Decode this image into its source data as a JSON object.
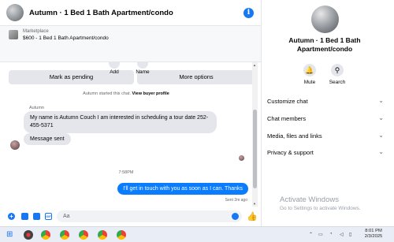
{
  "chat": {
    "header_title": "Autumn · 1 Bed 1 Bath Apartment/condo",
    "marketplace_label": "Marketplace",
    "listing": "$600 - 1 Bed 1 Bath Apartment/condo",
    "mark_pending_label": "Mark as pending",
    "more_options_label": "More options",
    "actions": {
      "add_label": "Add",
      "name_label": "Name"
    },
    "system_prefix": "Autumn started this chat.",
    "system_link": "View buyer profile",
    "sender_name": "Autumn",
    "incoming_message": "My name is Autumn Couch I am interested in scheduling a tour date 252-455-5371",
    "message_sent_label": "Message sent",
    "timestamp": "7:58PM",
    "outgoing_message": "I'll get in touch with you as soon as I can. Thanks",
    "sent_ago": "Sent 2m ago",
    "composer_placeholder": "Aa"
  },
  "sidebar": {
    "title": "Autumn · 1 Bed 1 Bath Apartment/condo",
    "mute_label": "Mute",
    "search_label": "Search",
    "rows": [
      {
        "label": "Customize chat"
      },
      {
        "label": "Chat members"
      },
      {
        "label": "Media, files and links"
      },
      {
        "label": "Privacy & support"
      }
    ]
  },
  "watermark": {
    "line1": "Activate Windows",
    "line2": "Go to Settings to activate Windows."
  },
  "taskbar": {
    "time": "8:01 PM",
    "date": "2/3/2025"
  },
  "colors": {
    "accent": "#1877f2",
    "outgoing_bubble": "#0a7cff",
    "incoming_bubble": "#e4e6eb"
  }
}
